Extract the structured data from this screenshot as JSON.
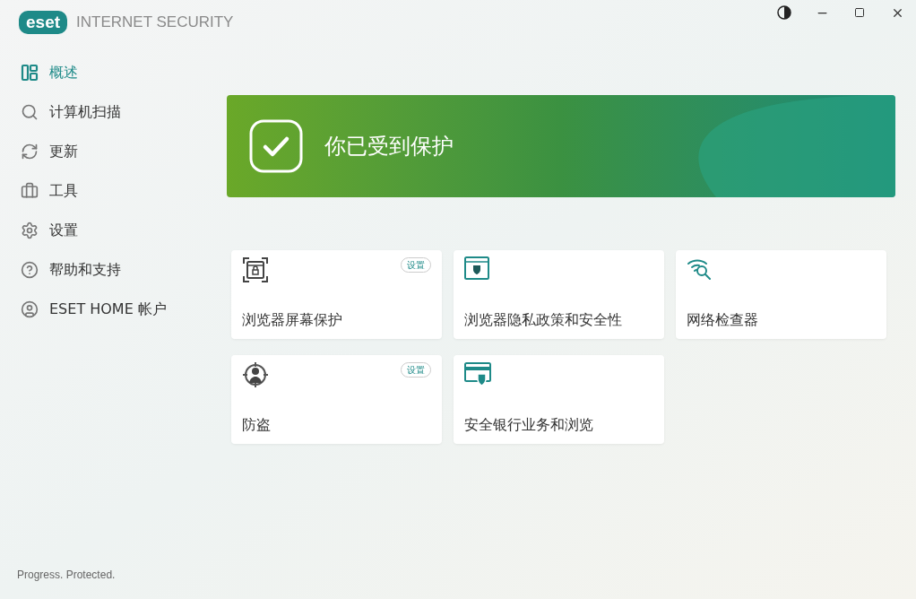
{
  "logo": "eset",
  "product": "INTERNET SECURITY",
  "sidebar": {
    "items": [
      {
        "label": "概述",
        "selected": true
      },
      {
        "label": "计算机扫描",
        "selected": false
      },
      {
        "label": "更新",
        "selected": false
      },
      {
        "label": "工具",
        "selected": false
      },
      {
        "label": "设置",
        "selected": false
      },
      {
        "label": "帮助和支持",
        "selected": false
      },
      {
        "label": "ESET HOME 帐户",
        "selected": false
      }
    ]
  },
  "banner": {
    "title": "你已受到保护"
  },
  "cards": [
    {
      "title": "浏览器屏幕保护",
      "badge": "设置"
    },
    {
      "title": "浏览器隐私政策和安全性"
    },
    {
      "title": "网络检查器"
    },
    {
      "title": "防盗",
      "badge": "设置"
    },
    {
      "title": "安全银行业务和浏览"
    }
  ],
  "footer": "Progress. Protected."
}
